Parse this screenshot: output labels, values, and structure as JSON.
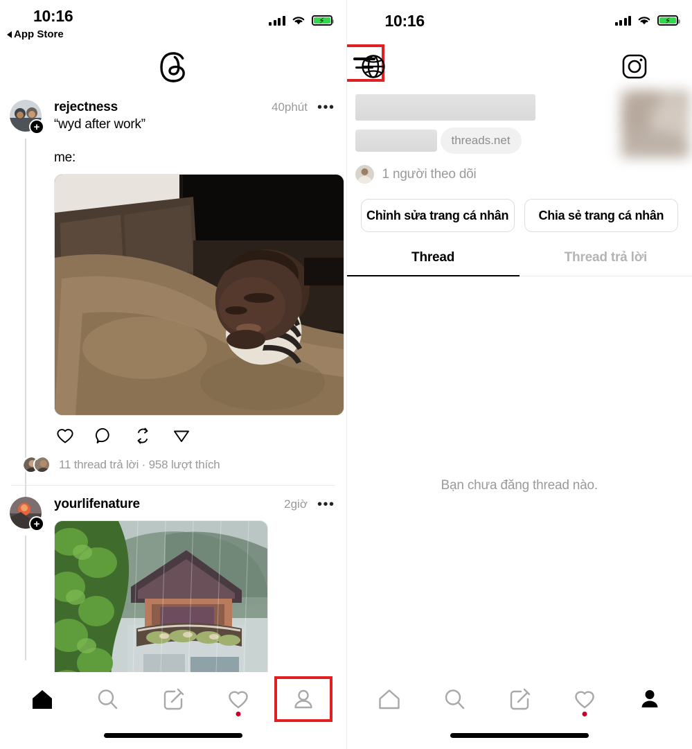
{
  "left_screen": {
    "status_bar": {
      "time": "10:16",
      "back_label": "App Store",
      "signal_icon": "cellular-signal-icon",
      "wifi_icon": "wifi-icon",
      "battery_icon": "battery-charging-icon",
      "battery_color": "#32d74b"
    },
    "header": {
      "logo_icon": "threads-logo-icon"
    },
    "posts": [
      {
        "username": "rejectness",
        "time": "40phút",
        "more_icon": "more-options-icon",
        "text": "“wyd after work”",
        "text2": "me:",
        "media": "sleeping-man-meme-image",
        "actions": [
          "heart-icon",
          "comment-icon",
          "repost-icon",
          "share-icon"
        ],
        "stats": "11 thread trả lời · 958 lượt thích"
      },
      {
        "username": "yourlifenature",
        "time": "2giờ",
        "more_icon": "more-options-icon",
        "media": "house-in-rain-image"
      }
    ],
    "bottom_nav": [
      {
        "icon": "home-icon",
        "active": true,
        "highlight": false,
        "dot": false
      },
      {
        "icon": "search-icon",
        "active": false,
        "highlight": false,
        "dot": false
      },
      {
        "icon": "compose-icon",
        "active": false,
        "highlight": false,
        "dot": false
      },
      {
        "icon": "heart-icon",
        "active": false,
        "highlight": false,
        "dot": true
      },
      {
        "icon": "profile-icon",
        "active": false,
        "highlight": true,
        "dot": false
      }
    ]
  },
  "right_screen": {
    "status_bar": {
      "time": "10:16",
      "signal_icon": "cellular-signal-icon",
      "wifi_icon": "wifi-icon",
      "battery_icon": "battery-charging-icon",
      "battery_color": "#32d74b"
    },
    "header": {
      "globe_icon": "globe-icon",
      "instagram_icon": "instagram-icon",
      "menu_icon": "hamburger-menu-icon",
      "menu_highlighted": true
    },
    "profile": {
      "display_name_redacted": true,
      "handle_redacted": true,
      "domain_pill": "threads.net",
      "avatar": "profile-picture-blurred",
      "followers": "1 người theo dõi",
      "edit_button": "Chỉnh sửa trang cá nhân",
      "share_button": "Chia sẻ trang cá nhân",
      "tabs": [
        {
          "label": "Thread",
          "active": true
        },
        {
          "label": "Thread trả lời",
          "active": false
        }
      ],
      "empty_state": "Bạn chưa đăng thread nào."
    },
    "bottom_nav": [
      {
        "icon": "home-icon",
        "active": false,
        "highlight": false,
        "dot": false
      },
      {
        "icon": "search-icon",
        "active": false,
        "highlight": false,
        "dot": false
      },
      {
        "icon": "compose-icon",
        "active": false,
        "highlight": false,
        "dot": false
      },
      {
        "icon": "heart-icon",
        "active": false,
        "highlight": false,
        "dot": true
      },
      {
        "icon": "profile-icon",
        "active": true,
        "highlight": false,
        "dot": false
      }
    ]
  },
  "accent_colors": {
    "highlight_red": "#e02020",
    "notification_dot": "#c9002a",
    "battery_green": "#32d74b"
  }
}
